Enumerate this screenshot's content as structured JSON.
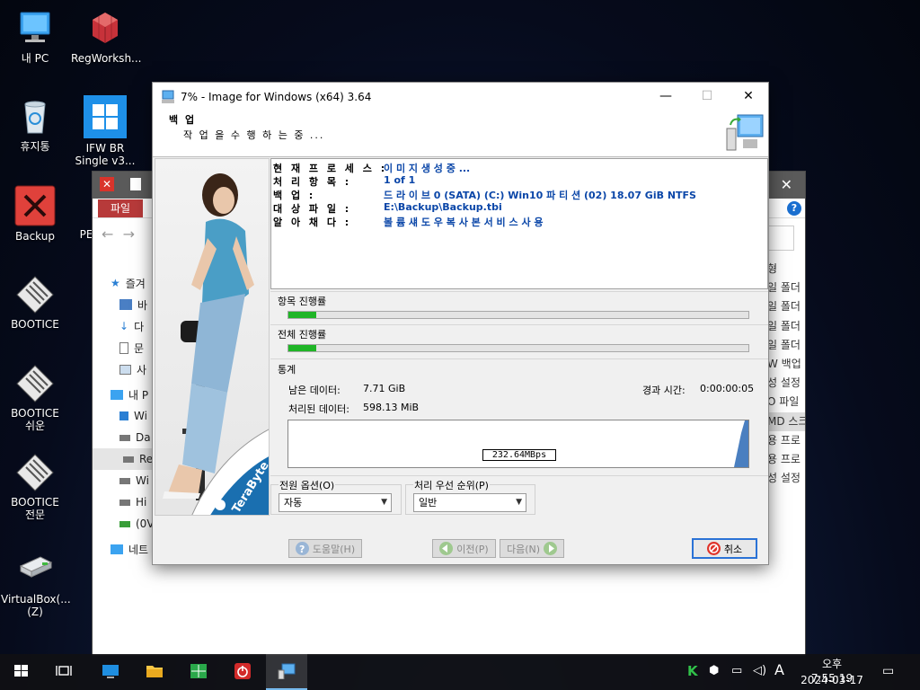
{
  "desktop": {
    "icons": [
      {
        "label": "내 PC",
        "icon": "computer-icon"
      },
      {
        "label": "RegWorksh...",
        "icon": "cubes-icon"
      },
      {
        "label": "휴지통",
        "icon": "recycle-bin-icon"
      },
      {
        "label": "IFW BR\nSingle v3...",
        "icon": "windows-logo-icon"
      },
      {
        "label": "Backup",
        "icon": "red-x-icon"
      },
      {
        "label": "PE",
        "icon": "pe-icon"
      },
      {
        "label": "BOOTICE",
        "icon": "bootice-icon"
      },
      {
        "label": "BOOTICE\n쉬운",
        "icon": "bootice-icon"
      },
      {
        "label": "BOOTICE\n전문",
        "icon": "bootice-icon"
      },
      {
        "label": "VirtualBox(...\n(Z)",
        "icon": "network-drive-icon"
      }
    ]
  },
  "explorer": {
    "file_tab": "파일",
    "nav_items": [
      "즐겨",
      "바",
      "다",
      "문",
      "사",
      "내 P",
      "Wi",
      "Da",
      "Re",
      "Wi",
      "Hi",
      "(0V",
      "네트"
    ],
    "right_items": [
      "형",
      "일 폴더",
      "일 폴더",
      "일 폴더",
      "일 폴더",
      "W 백업 :",
      "성 설정",
      "O 파일",
      "MD 스크",
      "용 프로",
      "용 프로",
      "성 설정"
    ]
  },
  "dialog": {
    "title": "7% - Image for Windows (x64) 3.64",
    "header_title": "백 업",
    "header_subtitle": "작 업 을 수 행 하 는 중 ...",
    "info": [
      {
        "key": "현 재 프 로 세 스 :",
        "value": "이 미 지 생 성 중 ..."
      },
      {
        "key": "처 리 항 목 :",
        "value": "1 of 1"
      },
      {
        "key": "백 업 :",
        "value": "드 라 이 브 0 (SATA) (C:) Win10 파 티 션 (02) 18.07 GiB NTFS"
      },
      {
        "key": "대 상 파 일 :",
        "value": "E:\\Backup\\Backup.tbi"
      },
      {
        "key": "알 아 채 다 :",
        "value": "볼 륨 섀 도 우 복 사 본 서 비 스 사 용"
      }
    ],
    "item_progress_label": "항목 진행률",
    "item_progress": 0.06,
    "total_progress_label": "전체 진행률",
    "total_progress": 0.06,
    "stats_label": "통계",
    "remaining_label": "남은 데이터:",
    "remaining_value": "7.71 GiB",
    "processed_label": "처리된 데이터:",
    "processed_value": "598.13 MiB",
    "elapsed_label": "경과 시간:",
    "elapsed_value": "0:00:00:05",
    "speed": "232.64MBps",
    "power_label": "전원 옵션(O)",
    "power_value": "자동",
    "priority_label": "처리 우선 순위(P)",
    "priority_value": "일반",
    "btn_help": "도움말(H)",
    "btn_prev": "이전(P)",
    "btn_next": "다음(N)",
    "btn_cancel": "취소"
  },
  "taskbar": {
    "time_ampm": "오후 7:55:19",
    "date": "2024-03-17",
    "ime": "A"
  },
  "colors": {
    "progress": "#1fb526",
    "info_value": "#0a46a8",
    "accent": "#2a72d6"
  }
}
